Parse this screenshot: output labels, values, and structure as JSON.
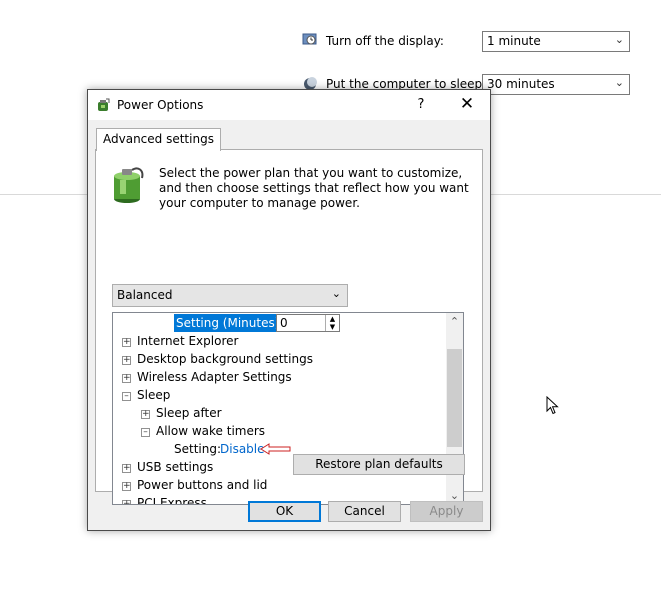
{
  "background": {
    "display_label": "Turn off the display:",
    "display_value": "1 minute",
    "sleep_label": "Put the computer to sleep:",
    "sleep_value": "30 minutes"
  },
  "dialog": {
    "title": "Power Options",
    "help_label": "?",
    "close_label": "✕",
    "tab_label": "Advanced settings",
    "description": "Select the power plan that you want to customize, and then choose settings that reflect how you want your computer to manage power.",
    "plan_select_value": "Balanced",
    "tree": {
      "setting_minutes_label": "Setting (Minutes):",
      "setting_minutes_value": "0",
      "items": [
        "Internet Explorer",
        "Desktop background settings",
        "Wireless Adapter Settings",
        "Sleep",
        "Sleep after",
        "Allow wake timers",
        "USB settings",
        "Power buttons and lid",
        "PCI Express"
      ],
      "wake_setting_label": "Setting:",
      "wake_setting_value": "Disable"
    },
    "restore_label": "Restore plan defaults",
    "ok_label": "OK",
    "cancel_label": "Cancel",
    "apply_label": "Apply"
  },
  "colors": {
    "accent": "#0078d7",
    "link": "#0066cc",
    "arrow": "#cc2222",
    "selection": "#0078d7"
  }
}
